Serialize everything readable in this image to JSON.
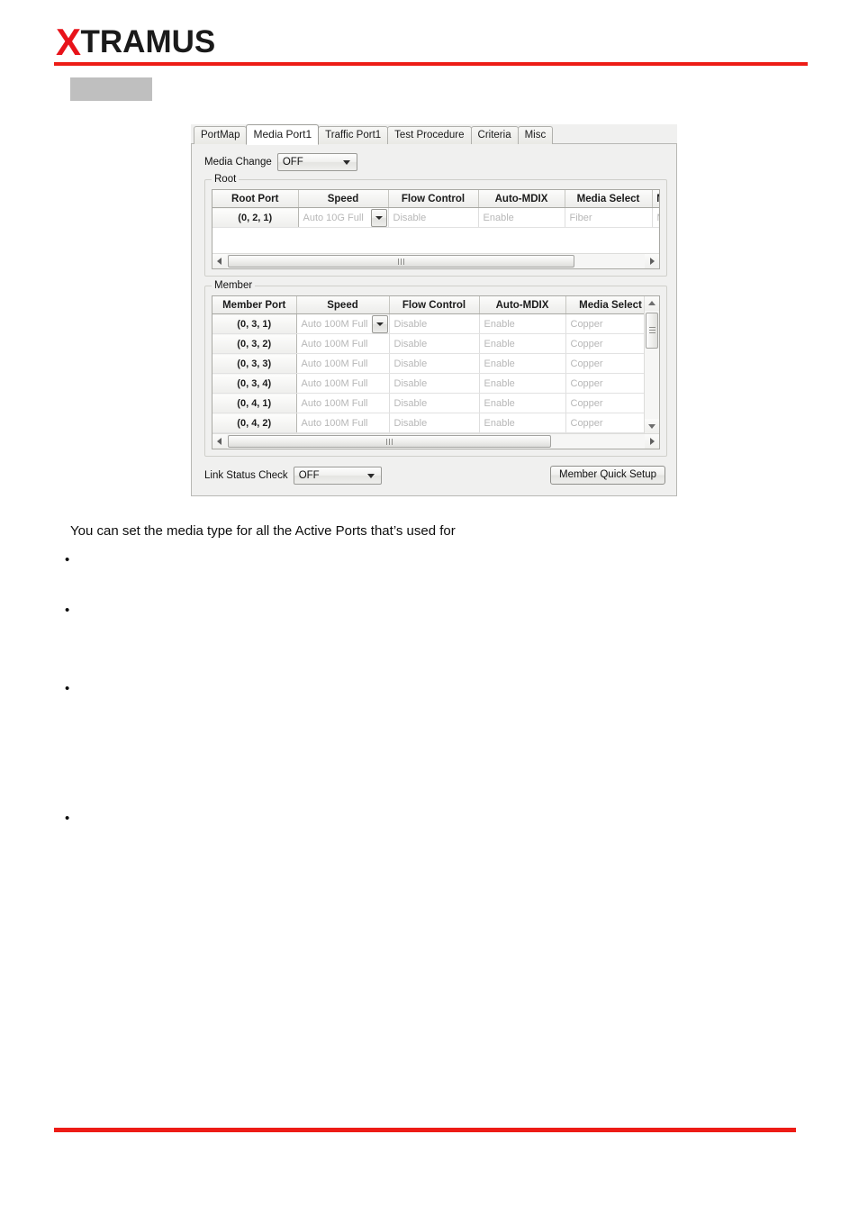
{
  "page": {
    "brand_x": "X",
    "brand_rest": "TRAMUS",
    "accent_color": "#ed1c16",
    "paragraph": "You can set the media type for all the Active Ports that’s used for",
    "bullets": [
      "",
      "",
      "",
      ""
    ]
  },
  "dialog": {
    "tabs": [
      {
        "label": "PortMap",
        "active": false
      },
      {
        "label": "Media Port1",
        "active": true
      },
      {
        "label": "Traffic Port1",
        "active": false
      },
      {
        "label": "Test Procedure",
        "active": false
      },
      {
        "label": "Criteria",
        "active": false
      },
      {
        "label": "Misc",
        "active": false
      }
    ],
    "media_change": {
      "label": "Media Change",
      "value": "OFF"
    },
    "root_group": {
      "legend": "Root",
      "columns": [
        "Root Port",
        "Speed",
        "Flow Control",
        "Auto-MDIX",
        "Media Select",
        "M"
      ],
      "rows": [
        {
          "port": "(0, 2, 1)",
          "speed": "Auto 10G Full",
          "flow_control": "Disable",
          "auto_mdix": "Enable",
          "media_select": "Fiber",
          "extra": "M"
        }
      ]
    },
    "member_group": {
      "legend": "Member",
      "columns": [
        "Member Port",
        "Speed",
        "Flow Control",
        "Auto-MDIX",
        "Media Select"
      ],
      "rows": [
        {
          "port": "(0, 3, 1)",
          "speed": "Auto 100M Full",
          "flow_control": "Disable",
          "auto_mdix": "Enable",
          "media_select": "Copper"
        },
        {
          "port": "(0, 3, 2)",
          "speed": "Auto 100M Full",
          "flow_control": "Disable",
          "auto_mdix": "Enable",
          "media_select": "Copper"
        },
        {
          "port": "(0, 3, 3)",
          "speed": "Auto 100M Full",
          "flow_control": "Disable",
          "auto_mdix": "Enable",
          "media_select": "Copper"
        },
        {
          "port": "(0, 3, 4)",
          "speed": "Auto 100M Full",
          "flow_control": "Disable",
          "auto_mdix": "Enable",
          "media_select": "Copper"
        },
        {
          "port": "(0, 4, 1)",
          "speed": "Auto 100M Full",
          "flow_control": "Disable",
          "auto_mdix": "Enable",
          "media_select": "Copper"
        },
        {
          "port": "(0, 4, 2)",
          "speed": "Auto 100M Full",
          "flow_control": "Disable",
          "auto_mdix": "Enable",
          "media_select": "Copper"
        }
      ]
    },
    "link_status_check": {
      "label": "Link Status Check",
      "value": "OFF"
    },
    "member_quick_setup": "Member Quick Setup"
  }
}
